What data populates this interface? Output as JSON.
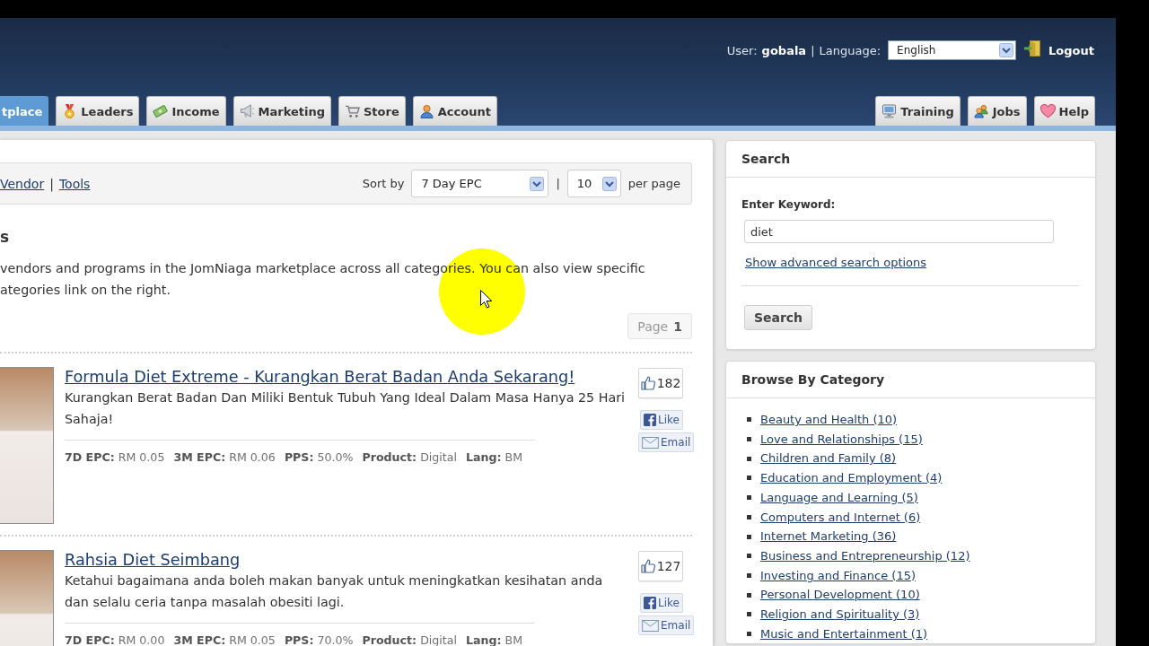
{
  "header": {
    "user_label": "User:",
    "username": "gobala",
    "separator": "|",
    "language_label": "Language:",
    "language_select": {
      "value": "English"
    },
    "logout": "Logout"
  },
  "nav": {
    "left_tabs": [
      {
        "label": "tplace",
        "selected": true
      },
      {
        "label": "Leaders",
        "selected": false
      },
      {
        "label": "Income",
        "selected": false
      },
      {
        "label": "Marketing",
        "selected": false
      },
      {
        "label": "Store",
        "selected": false
      },
      {
        "label": "Account",
        "selected": false
      }
    ],
    "right_tabs": [
      {
        "label": "Training",
        "selected": false
      },
      {
        "label": "Jobs",
        "selected": false
      },
      {
        "label": "Help",
        "selected": false
      }
    ]
  },
  "toolbar": {
    "links": [
      "Vendor",
      "Tools"
    ],
    "link_separator": "|",
    "sort_label": "Sort by",
    "sort_select": {
      "value": "7 Day EPC"
    },
    "separator": "|",
    "per_page_select": {
      "value": "10"
    },
    "per_page_label": "per page"
  },
  "heading": "s",
  "intro_lines": [
    "vendors and programs in the JomNiaga marketplace across all categories. You can also view specific",
    "ategories link on the right."
  ],
  "pager": {
    "label": "Page",
    "current": "1"
  },
  "products": [
    {
      "title": "Formula Diet Extreme - Kurangkan Berat Badan Anda Sekarang!",
      "description": "Kurangkan Berat Badan Dan Miliki Bentuk Tubuh Yang Ideal Dalam Masa Hanya 25 Hari Sahaja!",
      "stats": [
        {
          "label": "7D EPC:",
          "value": "RM 0.05"
        },
        {
          "label": "3M EPC:",
          "value": "RM 0.06"
        },
        {
          "label": "PPS:",
          "value": "50.0%"
        },
        {
          "label": "Product:",
          "value": "Digital"
        },
        {
          "label": "Lang:",
          "value": "BM"
        }
      ],
      "likes": "182",
      "like_button": "Like",
      "email_button": "Email"
    },
    {
      "title": "Rahsia Diet Seimbang",
      "description": "Ketahui bagaimana anda boleh makan banyak untuk meningkatkan kesihatan anda dan selalu ceria tanpa masalah obesiti lagi.",
      "stats": [
        {
          "label": "7D EPC:",
          "value": "RM 0.00"
        },
        {
          "label": "3M EPC:",
          "value": "RM 0.05"
        },
        {
          "label": "PPS:",
          "value": "70.0%"
        },
        {
          "label": "Product:",
          "value": "Digital"
        },
        {
          "label": "Lang:",
          "value": "BM"
        }
      ],
      "likes": "127",
      "like_button": "Like",
      "email_button": "Email"
    }
  ],
  "search_card": {
    "title": "Search",
    "keyword_label": "Enter Keyword:",
    "keyword_field": {
      "value": "diet"
    },
    "advanced_link": "Show advanced search options",
    "button": "Search"
  },
  "category_card": {
    "title": "Browse By Category",
    "categories": [
      "Beauty and Health (10)",
      "Love and Relationships (15)",
      "Children and Family (8)",
      "Education and Employment (4)",
      "Language and Learning (5)",
      "Computers and Internet (6)",
      "Internet Marketing (36)",
      "Business and Entrepreneurship (12)",
      "Investing and Finance (15)",
      "Personal Development (10)",
      "Religion and Spirituality (3)",
      "Music and Entertainment (1)"
    ]
  }
}
